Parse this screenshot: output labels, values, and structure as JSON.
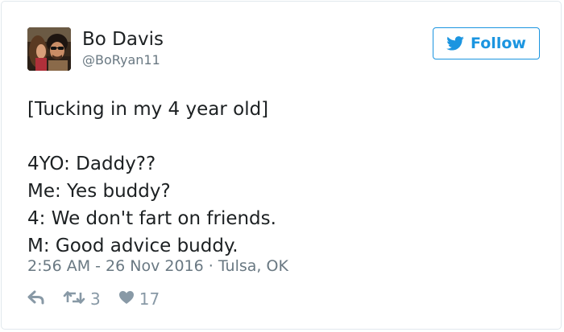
{
  "user": {
    "display_name": "Bo Davis",
    "handle": "@BoRyan11",
    "avatar_icon": "profile-photo"
  },
  "follow_button": {
    "label": "Follow",
    "icon": "twitter-bird-icon",
    "color": "#1b95e0"
  },
  "tweet": {
    "lines": [
      "[Tucking in my 4 year old]",
      "",
      "4YO: Daddy??",
      "Me: Yes buddy?",
      "4: We don't fart on friends.",
      "M: Good advice buddy."
    ]
  },
  "meta": {
    "timestamp": "2:56 AM - 26 Nov 2016 · Tulsa, OK"
  },
  "actions": {
    "reply_icon": "reply-icon",
    "retweet_icon": "retweet-icon",
    "retweet_count": "3",
    "like_icon": "heart-icon",
    "like_count": "17"
  },
  "colors": {
    "text": "#1c2022",
    "secondary_text": "#697882",
    "action_gray": "#8899a6",
    "border": "#e1e8ed",
    "brand_blue": "#1b95e0"
  }
}
